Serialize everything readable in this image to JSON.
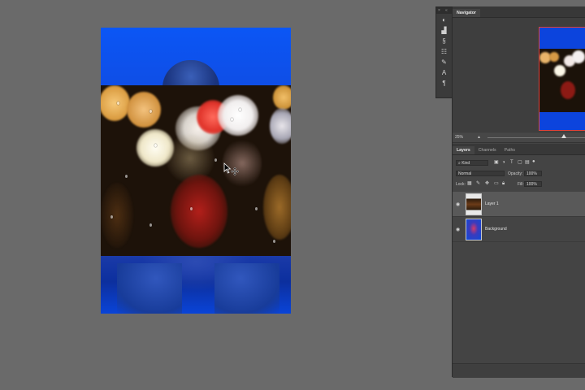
{
  "navigator": {
    "tab_label": "Navigator",
    "zoom_value": "25%"
  },
  "layers_panel": {
    "tabs": [
      "Layers",
      "Channels",
      "Paths"
    ],
    "filter_kind": "Kind",
    "blend_mode": "Normal",
    "opacity_label": "Opacity:",
    "opacity_value": "100%",
    "lock_label": "Lock:",
    "fill_label": "Fill:",
    "fill_value": "100%",
    "layers": [
      {
        "name": "Layer 1",
        "visible": true,
        "selected": true
      },
      {
        "name": "Background",
        "visible": true,
        "selected": false
      }
    ]
  },
  "tool_icons": [
    "adjustments-icon",
    "histogram-icon",
    "brush-settings-icon",
    "properties-icon",
    "brush-icon",
    "character-icon",
    "paragraph-icon"
  ],
  "colors": {
    "workspace": "#6a6a6a",
    "panel": "#444444",
    "selected_layer": "#595959",
    "navigator_view_box": "#e0413b",
    "canvas_blue": "#0b56f5"
  }
}
